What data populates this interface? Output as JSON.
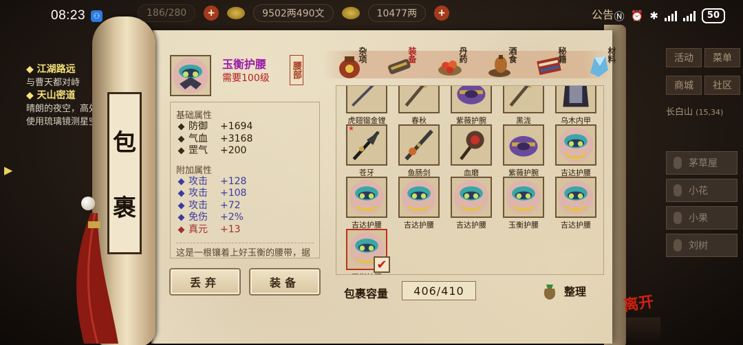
{
  "status_bar": {
    "time": "08:23",
    "battery": "50"
  },
  "topbar": {
    "bag_count": "186/280",
    "money": "9502两490文",
    "gold": "10477两",
    "notice": "公告",
    "plus": "+"
  },
  "left_quests": [
    {
      "title": "江湖路远",
      "desc": "与曹天都对峙"
    },
    {
      "title": "天山密道",
      "desc": "晴朗的夜空，高处使用琉璃镜测星空"
    }
  ],
  "right_panel": {
    "buttons": [
      "活动",
      "菜单",
      "商城",
      "社区"
    ],
    "location": "长白山",
    "coords": "(15,34)",
    "npcs": [
      "茅草屋",
      "小花",
      "小果",
      "刘树"
    ]
  },
  "scroll_title": [
    "包",
    "裹"
  ],
  "item": {
    "name": "玉衡护腰",
    "requirement": "需要100级",
    "slot": "腰部",
    "base_heading": "基础属性",
    "base_attrs": [
      {
        "name": "防御",
        "value": "+1694"
      },
      {
        "name": "气血",
        "value": "+3168"
      },
      {
        "name": "罡气",
        "value": "+200"
      }
    ],
    "extra_heading": "附加属性",
    "extra_attrs": [
      {
        "name": "攻击",
        "value": "+128"
      },
      {
        "name": "攻击",
        "value": "+108"
      },
      {
        "name": "攻击",
        "value": "+72"
      },
      {
        "name": "免伤",
        "value": "+2%"
      },
      {
        "name": "真元",
        "value": "+13"
      }
    ],
    "description": "这是一根镶着上好玉衡的腰带，据说能滋养人的体魄与精神"
  },
  "categories": [
    {
      "label": "杂项",
      "icon": "jar-icon",
      "active": false
    },
    {
      "label": "装备",
      "icon": "equipment-icon",
      "active": true
    },
    {
      "label": "丹药",
      "icon": "pill-icon",
      "active": false
    },
    {
      "label": "酒食",
      "icon": "food-icon",
      "active": false
    },
    {
      "label": "秘籍",
      "icon": "book-icon",
      "active": false
    },
    {
      "label": "材料",
      "icon": "crystal-icon",
      "active": false
    }
  ],
  "inventory": [
    {
      "name": "虎翅镏金镗",
      "icon": "spear-icon"
    },
    {
      "name": "春秋",
      "icon": "blade-icon"
    },
    {
      "name": "紫薇护腕",
      "icon": "bracer-icon"
    },
    {
      "name": "黑泷",
      "icon": "blade-icon"
    },
    {
      "name": "乌木内甲",
      "icon": "armor-icon"
    },
    {
      "name": "苍牙",
      "icon": "claw-weapon-icon"
    },
    {
      "name": "鱼肠剑",
      "icon": "sword-icon"
    },
    {
      "name": "血磨",
      "icon": "spiked-mace-icon"
    },
    {
      "name": "紫薇护腕",
      "icon": "bracer-icon"
    },
    {
      "name": "吉达护腰",
      "icon": "belt-icon"
    },
    {
      "name": "吉达护腰",
      "icon": "belt-icon"
    },
    {
      "name": "吉达护腰",
      "icon": "belt-icon"
    },
    {
      "name": "吉达护腰",
      "icon": "belt-icon"
    },
    {
      "name": "玉衡护腰",
      "icon": "belt-icon"
    },
    {
      "name": "吉达护腰",
      "icon": "belt-icon"
    },
    {
      "name": "玉衡护腰",
      "icon": "belt-icon",
      "selected": true
    }
  ],
  "buttons": {
    "discard": "丢弃",
    "equip": "装备"
  },
  "capacity": {
    "label": "包裹容量",
    "value": "406/410"
  },
  "sort_label": "整理",
  "leave_label": "离开",
  "colors": {
    "accent_red": "#b02020",
    "item_name": "#9a1aa8",
    "extra_attr": "#3a3aa0"
  }
}
